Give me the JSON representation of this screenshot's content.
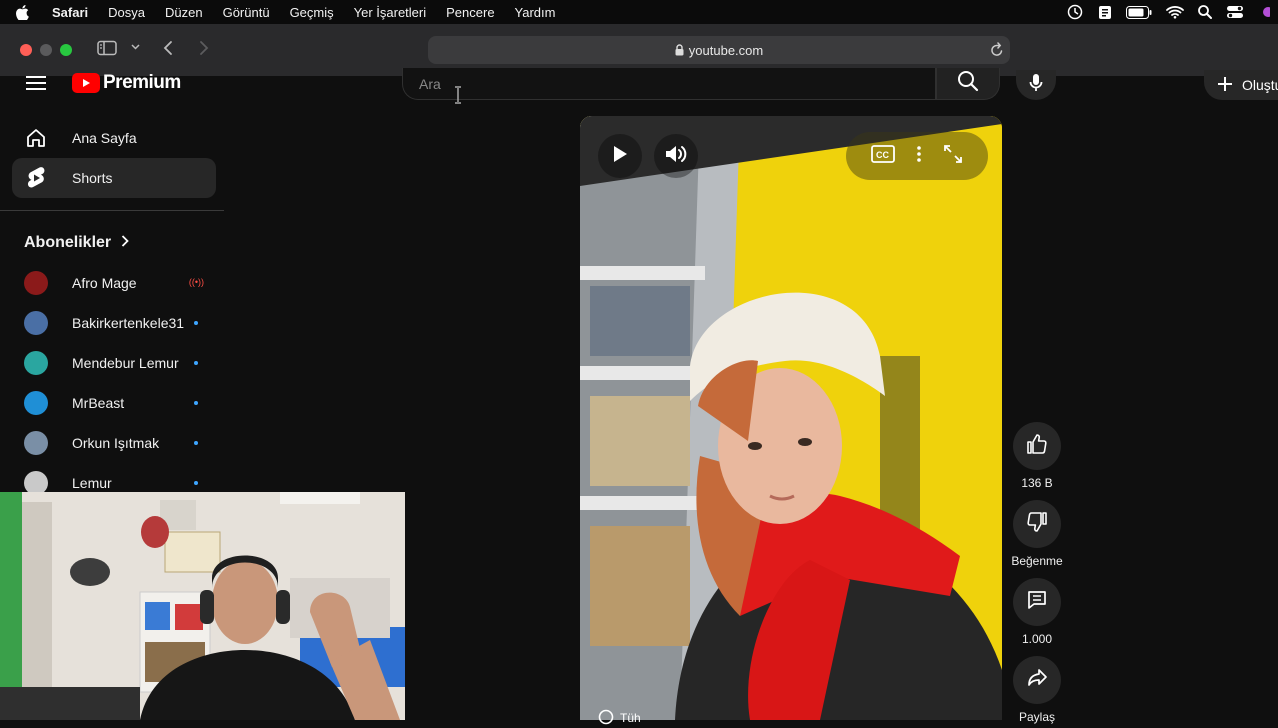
{
  "menubar": {
    "app": "Safari",
    "items": [
      "Dosya",
      "Düzen",
      "Görüntü",
      "Geçmiş",
      "Yer İşaretleri",
      "Pencere",
      "Yardım"
    ]
  },
  "browser": {
    "url": "youtube.com"
  },
  "header": {
    "logo_text": "Premium",
    "search_placeholder": "Ara",
    "create_label": "Oluştur"
  },
  "sidebar": {
    "nav": [
      {
        "label": "Ana Sayfa",
        "icon": "home-icon"
      },
      {
        "label": "Shorts",
        "icon": "shorts-icon"
      }
    ],
    "subscriptions_title": "Abonelikler",
    "subscriptions": [
      {
        "name": "Afro Mage",
        "status": "live",
        "color": "#8b1a1a"
      },
      {
        "name": "Bakirkertenkele31",
        "status": "new",
        "color": "#4a6fa5"
      },
      {
        "name": "Mendebur Lemur",
        "status": "new",
        "color": "#2aa6a0"
      },
      {
        "name": "MrBeast",
        "status": "new",
        "color": "#1f8fd6"
      },
      {
        "name": "Orkun Işıtmak",
        "status": "new",
        "color": "#7a8fa6"
      },
      {
        "name": "Lemur",
        "status": "new",
        "color": "#c9c9c9"
      }
    ]
  },
  "video": {
    "bottom_chip": "Tüh"
  },
  "actions": {
    "like_count": "136 B",
    "dislike_label": "Beğenme",
    "comment_count": "1.000",
    "share_label": "Paylaş"
  }
}
